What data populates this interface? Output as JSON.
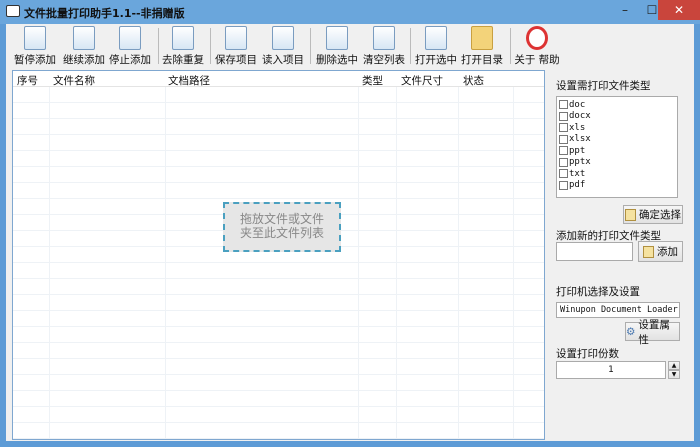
{
  "window": {
    "title": "文件批量打印助手1.1--非捐赠版",
    "min": "–",
    "max": "☐",
    "close": "✕"
  },
  "toolbar": [
    {
      "id": "pause-add",
      "label": "暂停添加"
    },
    {
      "id": "continue-add",
      "label": "继续添加"
    },
    {
      "id": "stop-add",
      "label": "停止添加"
    },
    {
      "id": "remove-duplicates",
      "label": "去除重复"
    },
    {
      "id": "save-project",
      "label": "保存项目"
    },
    {
      "id": "load-project",
      "label": "读入项目"
    },
    {
      "id": "delete-selected",
      "label": "删除选中"
    },
    {
      "id": "clear-list",
      "label": "清空列表"
    },
    {
      "id": "open-selected",
      "label": "打开选中"
    },
    {
      "id": "open-directory",
      "label": "打开目录"
    },
    {
      "id": "about-help",
      "label": "关于 帮助"
    }
  ],
  "list": {
    "columns": [
      "序号",
      "文件名称",
      "文档路径",
      "类型",
      "文件尺寸",
      "状态"
    ],
    "drop_hint_1": "拖放文件或文件",
    "drop_hint_2": "夹至此文件列表"
  },
  "panel": {
    "types_label": "设置需打印文件类型",
    "types": [
      "doc",
      "docx",
      "xls",
      "xlsx",
      "ppt",
      "pptx",
      "txt",
      "pdf"
    ],
    "confirm_label": "确定选择",
    "add_type_label": "添加新的打印文件类型",
    "add_type_value": "",
    "add_button": "添加",
    "printer_label": "打印机选择及设置",
    "printer_value": "Winupon Document Loader",
    "printer_arrow": "∨",
    "properties_button": "设置属性",
    "copies_label": "设置打印份数",
    "copies_value": "1",
    "up": "▲",
    "down": "▼"
  }
}
